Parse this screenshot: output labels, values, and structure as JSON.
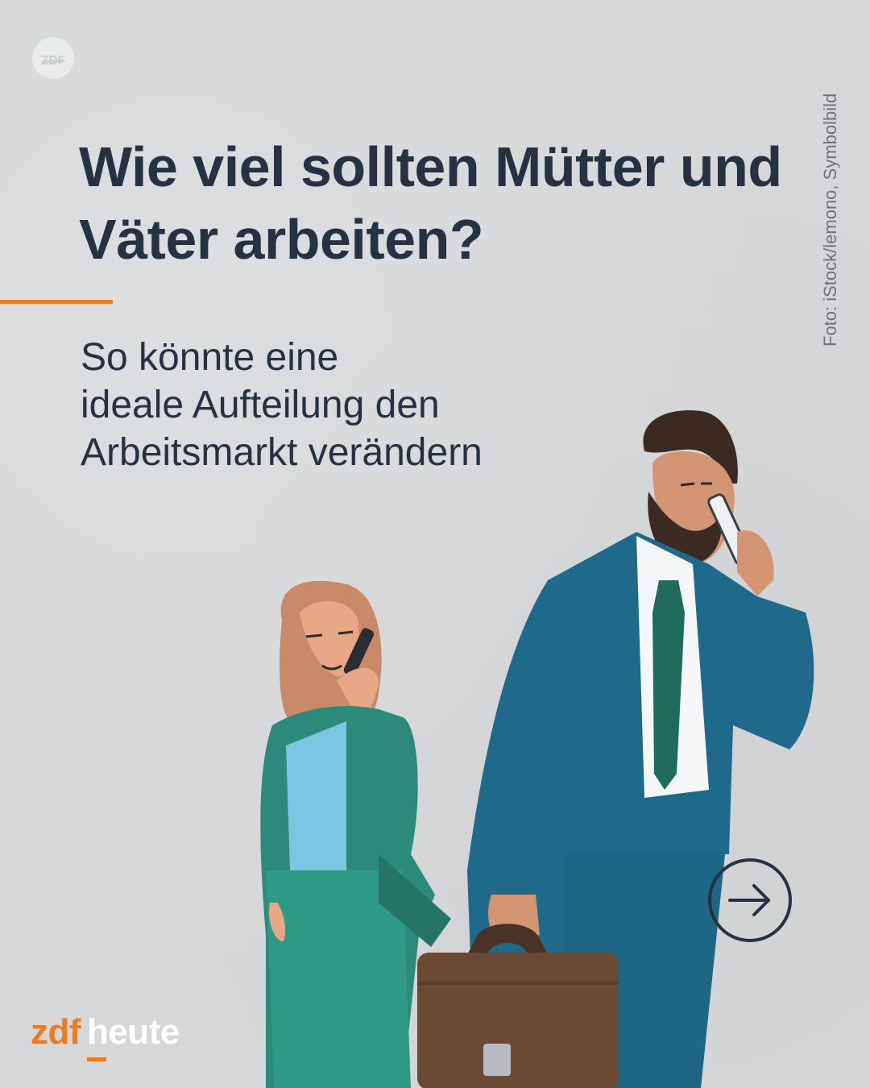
{
  "headline": "Wie viel sollten Mütter und Väter arbeiten?",
  "subtitle": {
    "line1": "So könnte eine",
    "line2": "ideale Aufteilung den",
    "line3": "Arbeitsmarkt verändern"
  },
  "photo_credit": "Foto: iStock/lemono, Symbolbild",
  "brand": {
    "part1": "zdf",
    "part2": "heute"
  },
  "top_logo_text": "ZDF",
  "next_icon": "arrow-right-circle-icon",
  "colors": {
    "background": "#d5d7d8",
    "text_dark": "#263241",
    "accent_orange": "#f07a1e",
    "credit_gray": "#6f7377",
    "suit_blue": "#1f6a8a",
    "woman_suit_teal": "#2b8a7a",
    "briefcase_brown": "#6b4a35"
  }
}
